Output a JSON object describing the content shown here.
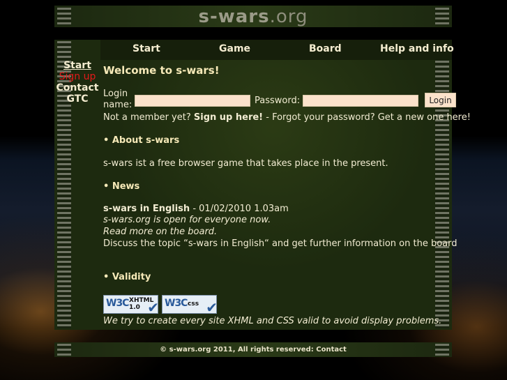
{
  "header": {
    "logo_main": "s-wars",
    "logo_tld": ".org"
  },
  "nav": {
    "start": "Start",
    "game": "Game",
    "board": "Board",
    "help": "Help and info"
  },
  "sidebar": {
    "items": [
      {
        "label": "Start"
      },
      {
        "label": "Sign up"
      },
      {
        "label": "Contact"
      },
      {
        "label": "GTC"
      }
    ]
  },
  "content": {
    "welcome": "Welcome to s-wars!",
    "login_label": "Login name:",
    "login_value": "",
    "password_label": "Password:",
    "password_value": "",
    "login_button": "Login",
    "member_prefix": "Not a member yet?",
    "signup_link": "Sign up here!",
    "forgot_text": "- Forgot your password? Get a new one here!",
    "about_heading": "• About s-wars",
    "about_text": "s-wars ist a free browser game that takes place in the present.",
    "news_heading": "• News",
    "news_title": "s-wars in English",
    "news_date": "- 01/02/2010 1.03am",
    "news_line1": "s-wars.org is open for everyone now.",
    "news_line2": "Read more on the board.",
    "news_discuss": "Discuss the topic “s-wars in English“ and get further information on the board",
    "validity_heading": "• Validity",
    "badge_xhtml": {
      "w3c": "W3C",
      "label1": "XHTML",
      "label2": "1.0"
    },
    "badge_css": {
      "w3c": "W3C",
      "label1": "css"
    },
    "validity_note": "We try to create every site XHML and CSS valid to avoid display problems."
  },
  "footer": {
    "text": "© s-wars.org 2011, All rights reserved:",
    "contact": "Contact"
  }
}
